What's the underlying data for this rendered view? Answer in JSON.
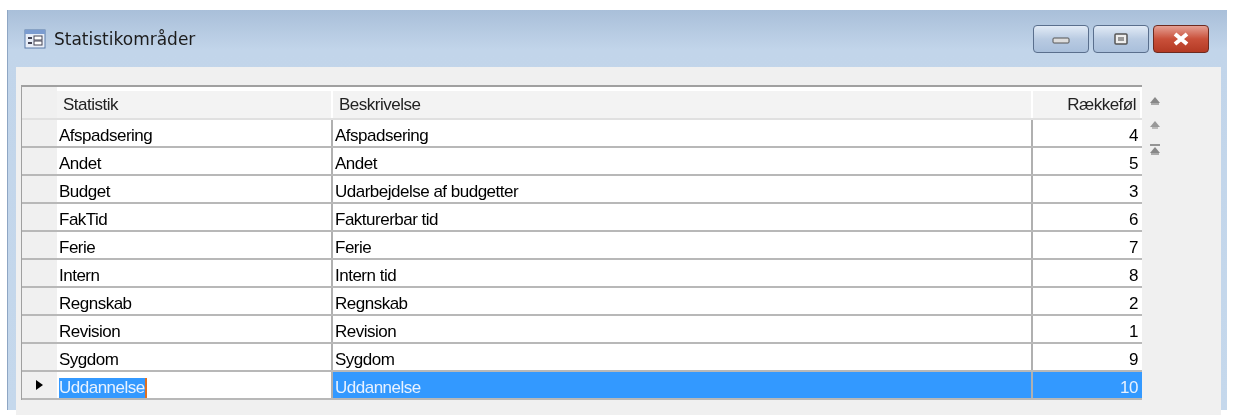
{
  "window": {
    "title": "Statistikområder"
  },
  "table": {
    "columns": [
      "Statistik",
      "Beskrivelse",
      "Rækkeføl"
    ],
    "rows": [
      {
        "cells": [
          "Afspadsering",
          "Afspadsering",
          "4"
        ],
        "selected": false
      },
      {
        "cells": [
          "Andet",
          "Andet",
          "5"
        ],
        "selected": false
      },
      {
        "cells": [
          "Budget",
          "Udarbejdelse af budgetter",
          "3"
        ],
        "selected": false
      },
      {
        "cells": [
          "FakTid",
          "Fakturerbar tid",
          "6"
        ],
        "selected": false
      },
      {
        "cells": [
          "Ferie",
          "Ferie",
          "7"
        ],
        "selected": false
      },
      {
        "cells": [
          "Intern",
          "Intern tid",
          "8"
        ],
        "selected": false
      },
      {
        "cells": [
          "Regnskab",
          "Regnskab",
          "2"
        ],
        "selected": false
      },
      {
        "cells": [
          "Revision",
          "Revision",
          "1"
        ],
        "selected": false
      },
      {
        "cells": [
          "Sygdom",
          "Sygdom",
          "9"
        ],
        "selected": false
      },
      {
        "cells": [
          "Uddannelse",
          "Uddannelse",
          "10"
        ],
        "selected": true
      }
    ]
  }
}
